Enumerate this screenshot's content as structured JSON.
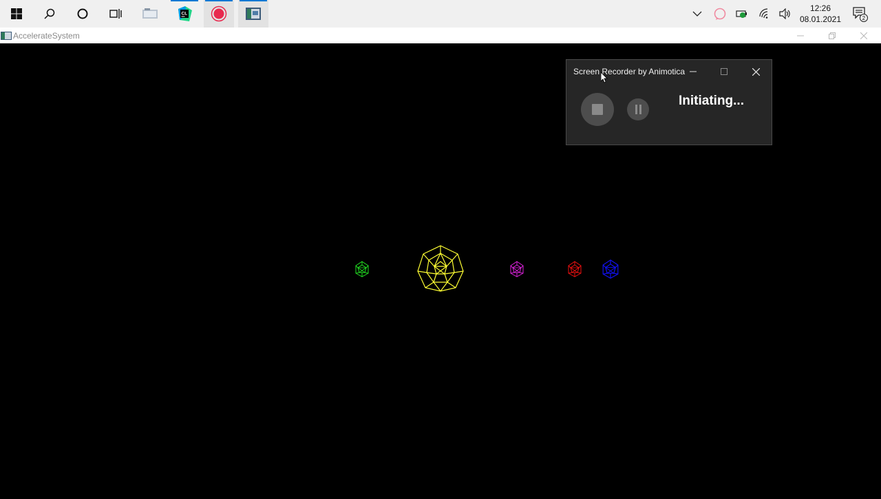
{
  "taskbar": {
    "items": [
      "start-icon",
      "search-icon",
      "cortana-icon",
      "task-view-icon",
      "explorer-app-icon",
      "clion-app-icon",
      "screen-recorder-app-icon",
      "accelerate-system-app-icon"
    ],
    "clion_label": "CL",
    "tray": {
      "notifications_count": "2"
    },
    "clock": {
      "time": "12:26",
      "date": "08.01.2021"
    }
  },
  "app_window": {
    "title": "AccelerateSystem"
  },
  "recorder": {
    "title": "Screen Recorder by Animotica",
    "status": "Initiating..."
  },
  "colors": {
    "taskbar_bg": "#f0f0f0",
    "accent": "#0078d4",
    "recorder_red": "#e8294e",
    "sun": "#ffff33",
    "planet_green": "#22dd22",
    "planet_magenta": "#dd22dd",
    "planet_red": "#ee1111",
    "planet_blue": "#1111ee"
  },
  "scene": {
    "bodies": [
      "green-planet",
      "yellow-sun",
      "magenta-planet",
      "red-planet",
      "blue-planet"
    ]
  }
}
